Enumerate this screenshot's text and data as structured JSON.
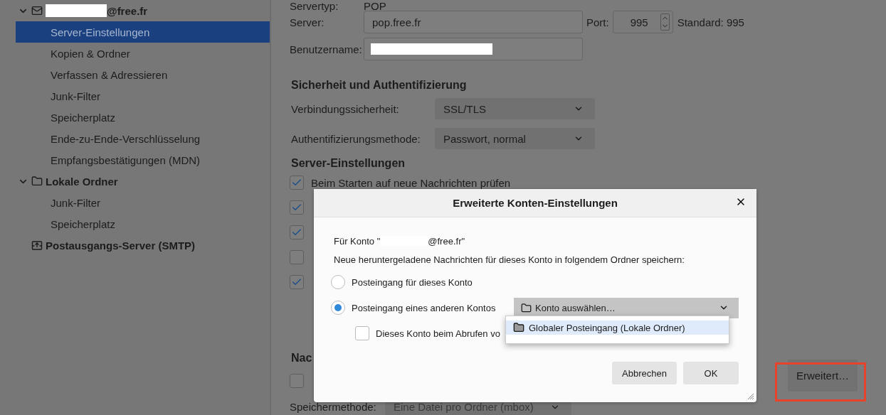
{
  "sidebar": {
    "accounts": [
      {
        "kind": "mail",
        "name": "@free.fr",
        "redacted": true,
        "expanded": true,
        "children": [
          {
            "label": "Server-Einstellungen",
            "selected": true
          },
          {
            "label": "Kopien & Ordner",
            "selected": false
          },
          {
            "label": "Verfassen & Adressieren",
            "selected": false
          },
          {
            "label": "Junk-Filter",
            "selected": false
          },
          {
            "label": "Speicherplatz",
            "selected": false
          },
          {
            "label": "Ende-zu-Ende-Verschlüsselung",
            "selected": false
          },
          {
            "label": "Empfangsbestätigungen (MDN)",
            "selected": false
          }
        ]
      },
      {
        "kind": "folder",
        "name": "Lokale Ordner",
        "redacted": false,
        "expanded": true,
        "children": [
          {
            "label": "Junk-Filter",
            "selected": false
          },
          {
            "label": "Speicherplatz",
            "selected": false
          }
        ]
      },
      {
        "kind": "outbox",
        "name": "Postausgangs-Server (SMTP)",
        "redacted": false
      }
    ]
  },
  "server_type": {
    "label": "Servertyp:",
    "value": "POP"
  },
  "server": {
    "label": "Server:",
    "value": "pop.free.fr"
  },
  "port": {
    "label": "Port:",
    "value": "995",
    "default": "Standard: 995"
  },
  "username": {
    "label": "Benutzername:",
    "redacted": true
  },
  "security": {
    "heading": "Sicherheit und Authentifizierung",
    "rows": [
      {
        "label": "Verbindungssicherheit:",
        "value": "SSL/TLS"
      },
      {
        "label": "Authentifizierungsmethode:",
        "value": "Passwort, normal"
      }
    ]
  },
  "server_settings": {
    "heading": "Server-Einstellungen",
    "options": [
      {
        "label": "Beim Starten auf neue Nachrichten prüfen",
        "checked": true
      },
      {
        "checked": true
      },
      {
        "checked": true
      },
      {
        "checked": false
      },
      {
        "checked": true
      }
    ]
  },
  "message_storage": {
    "heading": "Nac",
    "options": [
      {
        "checked": false
      }
    ],
    "method_label": "Speichermethode:",
    "method_value": "Eine Datei pro Ordner (mbox)"
  },
  "advanced_button": {
    "label": "Erweitert…",
    "highlighted": true
  },
  "dialog": {
    "title": "Erweiterte Konten-Einstellungen",
    "account_prefix": "Für Konto \"",
    "account_redacted": true,
    "account_suffix": "@free.fr\"",
    "prompt": "Neue heruntergeladene Nachrichten für dieses Konto in folgendem Ordner speichern:",
    "radios": [
      {
        "label": "Posteingang für dieses Konto",
        "selected": false
      },
      {
        "label": "Posteingang eines anderen Kontos",
        "selected": true
      }
    ],
    "account_select": {
      "value": "Konto auswählen…",
      "open": true
    },
    "popup_items": [
      {
        "label": "Globaler Posteingang (Lokale Ordner)",
        "selected": true
      }
    ],
    "checkbox": {
      "label": "Dieses Konto beim Abrufen vo",
      "checked": false
    },
    "buttons": [
      "Abbrechen",
      "OK"
    ]
  }
}
